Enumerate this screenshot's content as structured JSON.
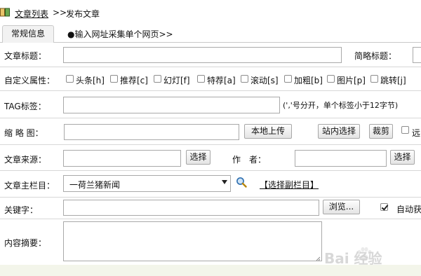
{
  "breadcrumb": {
    "link": "文章列表",
    "separator": ">>",
    "current": "发布文章"
  },
  "tabs": {
    "active": "常规信息",
    "inactive": "●输入网址采集单个网页>>"
  },
  "title_row": {
    "label": "文章标题：",
    "short_label": "简略标题："
  },
  "attr_row": {
    "label": "自定义属性：",
    "options": [
      {
        "label": "头条[h]"
      },
      {
        "label": "推荐[c]"
      },
      {
        "label": "幻灯[f]"
      },
      {
        "label": "特荐[a]"
      },
      {
        "label": "滚动[s]"
      },
      {
        "label": "加粗[b]"
      },
      {
        "label": "图片[p]"
      },
      {
        "label": "跳转[j]"
      }
    ]
  },
  "tag_row": {
    "label": "TAG标签：",
    "hint": "(','号分开，单个标签小于12字节)"
  },
  "thumb_row": {
    "label": "缩 略 图：",
    "upload_button": "本地上传",
    "site_select_button": "站内选择",
    "crop_button": "裁剪",
    "remote_label": "远"
  },
  "source_row": {
    "label": "文章来源：",
    "select_button": "选择",
    "author_label": "作　者：",
    "author_select_button": "选择"
  },
  "column_row": {
    "label": "文章主栏目：",
    "selected": "一荷兰猪新闻",
    "sub_column_link": "【选择副栏目】"
  },
  "keyword_row": {
    "label": "关键字：",
    "browse_button": "浏览...",
    "auto_label": "自动获"
  },
  "summary_row": {
    "label": "内容摘要："
  },
  "watermark": {
    "text": "Bai 经验"
  }
}
